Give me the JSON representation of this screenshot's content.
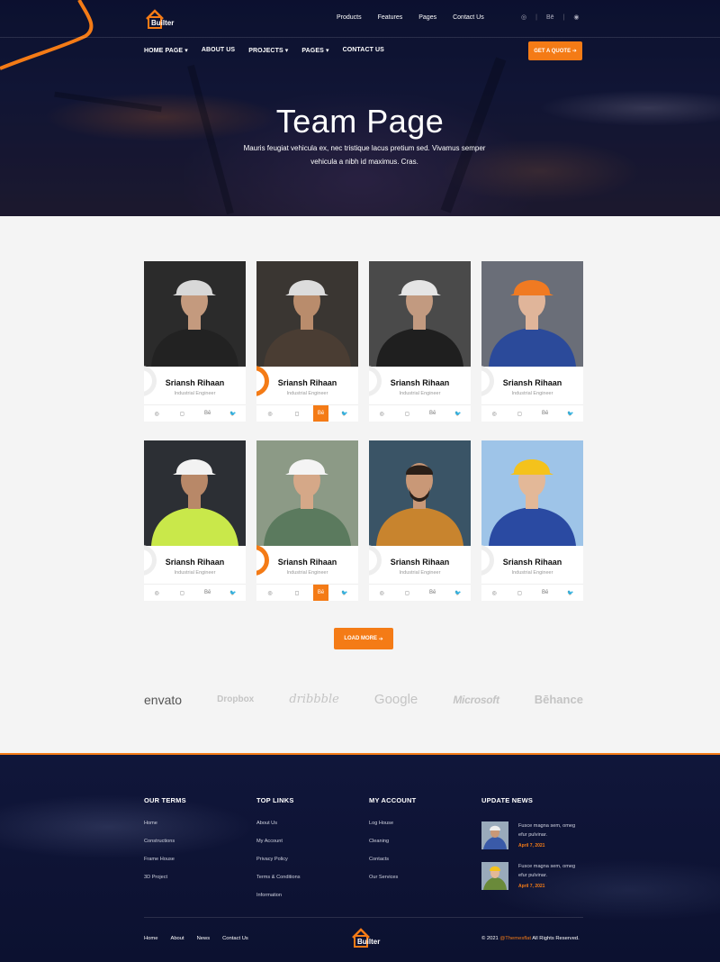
{
  "header": {
    "logo_text": "Builter",
    "top_links": [
      "Products",
      "Features",
      "Pages",
      "Contact Us"
    ],
    "top_socials": [
      {
        "icon": "dribbble-icon",
        "glyph": "◎"
      },
      {
        "sep": "|"
      },
      {
        "icon": "behance-icon",
        "glyph": "Bē"
      },
      {
        "sep": "|"
      },
      {
        "icon": "pinterest-icon",
        "glyph": "◉"
      }
    ],
    "nav": [
      {
        "label": "HOME PAGE",
        "dropdown": true,
        "active": false
      },
      {
        "label": "ABOUT US",
        "dropdown": false,
        "active": false
      },
      {
        "label": "PROJECTS",
        "dropdown": true,
        "active": false
      },
      {
        "label": "PAGES",
        "dropdown": true,
        "active": true
      },
      {
        "label": "CONTACT US",
        "dropdown": false,
        "active": false
      }
    ],
    "quote_button": "GET A QUOTE",
    "accent_color": "#f47b16"
  },
  "hero": {
    "title": "Team Page",
    "subtitle": "Mauris feugiat vehicula ex, nec tristique lacus pretium sed. Vivamus semper vehicula a nibh id maximus. Cras."
  },
  "team": {
    "members": [
      {
        "name": "Sriansh Rihaan",
        "role": "Industrial Engineer",
        "highlight": false,
        "helmet": "#d8d8d8",
        "shirt": "#222",
        "bg": "#2b2b2b",
        "skin": "#c49a7e"
      },
      {
        "name": "Sriansh Rihaan",
        "role": "Industrial Engineer",
        "highlight": true,
        "helmet": "#dcdcdc",
        "shirt": "#4a3d33",
        "bg": "#3a3632",
        "skin": "#b98c6c"
      },
      {
        "name": "Sriansh Rihaan",
        "role": "Industrial Engineer",
        "highlight": false,
        "helmet": "#e5e5e5",
        "shirt": "#1f1f1f",
        "bg": "#4a4a4a",
        "skin": "#c29a80"
      },
      {
        "name": "Sriansh Rihaan",
        "role": "Industrial Engineer",
        "highlight": false,
        "helmet": "#f07a22",
        "shirt": "#2b4a9a",
        "bg": "#6a6e78",
        "skin": "#e0b59a"
      },
      {
        "name": "Sriansh Rihaan",
        "role": "Industrial Engineer",
        "highlight": false,
        "helmet": "#f2f2f2",
        "shirt": "#c9e84a",
        "bg": "#2c2f34",
        "skin": "#b88868"
      },
      {
        "name": "Sriansh Rihaan",
        "role": "Industrial Engineer",
        "highlight": true,
        "helmet": "#f4f4f4",
        "shirt": "#5b7a5e",
        "bg": "#8c9a86",
        "skin": "#d5a888"
      },
      {
        "name": "Sriansh Rihaan",
        "role": "Industrial Engineer",
        "highlight": false,
        "helmet": "none",
        "shirt": "#c8842e",
        "bg": "#3a5466",
        "skin": "#c99877"
      },
      {
        "name": "Sriansh Rihaan",
        "role": "Industrial Engineer",
        "highlight": false,
        "helmet": "#f4c21c",
        "shirt": "#2a4aa2",
        "bg": "#9ec4e8",
        "skin": "#e3b898"
      }
    ],
    "social_icons": [
      {
        "icon": "dribbble-icon",
        "glyph": "◎"
      },
      {
        "icon": "instagram-icon",
        "glyph": "◻"
      },
      {
        "icon": "behance-icon",
        "glyph": "Bē"
      },
      {
        "icon": "twitter-icon",
        "glyph": "🐦"
      }
    ],
    "load_more": "LOAD MORE"
  },
  "brands": [
    "envato",
    "Dropbox",
    "dribbble",
    "Google",
    "Microsoft",
    "Bēhance"
  ],
  "footer": {
    "columns": [
      {
        "title": "OUR TERMS",
        "items": [
          "Home",
          "Constructions",
          "Frame House",
          "3D Project"
        ]
      },
      {
        "title": "TOP LINKS",
        "items": [
          "About Us",
          "My Account",
          "Privacy Policy",
          "Terms & Conditions",
          "Information"
        ]
      },
      {
        "title": "MY ACCOUNT",
        "items": [
          "Log House",
          "Cleaning",
          "Contacts",
          "Our Services"
        ]
      }
    ],
    "news": {
      "title": "UPDATE NEWS",
      "items": [
        {
          "text": "Fusce magna sem, omeg efur pulvinar.",
          "date": "April 7, 2021"
        },
        {
          "text": "Fusce magna sem, omeg efur pulvinar.",
          "date": "April 7, 2021"
        }
      ]
    },
    "bottom_nav": [
      "Home",
      "About",
      "News",
      "Contact Us"
    ],
    "logo_text": "Builter",
    "copyright_prefix": "© 2021 ",
    "copyright_brand": "@Themesflat",
    "copyright_suffix": " All Rights Reserved."
  }
}
